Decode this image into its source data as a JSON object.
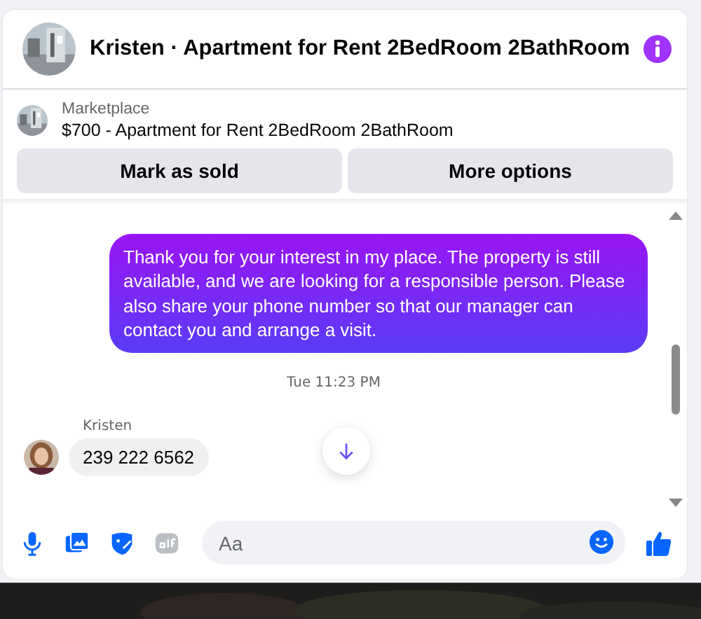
{
  "header": {
    "title": "Kristen · Apartment for Rent 2BedRoom 2BathRoom"
  },
  "listing": {
    "source": "Marketplace",
    "title": "$700 - Apartment for Rent 2BedRoom 2BathRoom"
  },
  "buttons": [
    {
      "label": "Mark as sold"
    },
    {
      "label": "More options"
    }
  ],
  "messages": [
    {
      "kind": "outgoing",
      "text": "Thank you for your interest in my place. The property is still available, and we are looking for a responsible person. Please also share your phone number so that our manager can contact you and arrange a visit."
    },
    {
      "kind": "time",
      "text": "Tue 11:23 PM"
    },
    {
      "kind": "incoming",
      "sender": "Kristen",
      "text": "239 222 6562"
    }
  ],
  "composer": {
    "placeholder": "Aa"
  }
}
